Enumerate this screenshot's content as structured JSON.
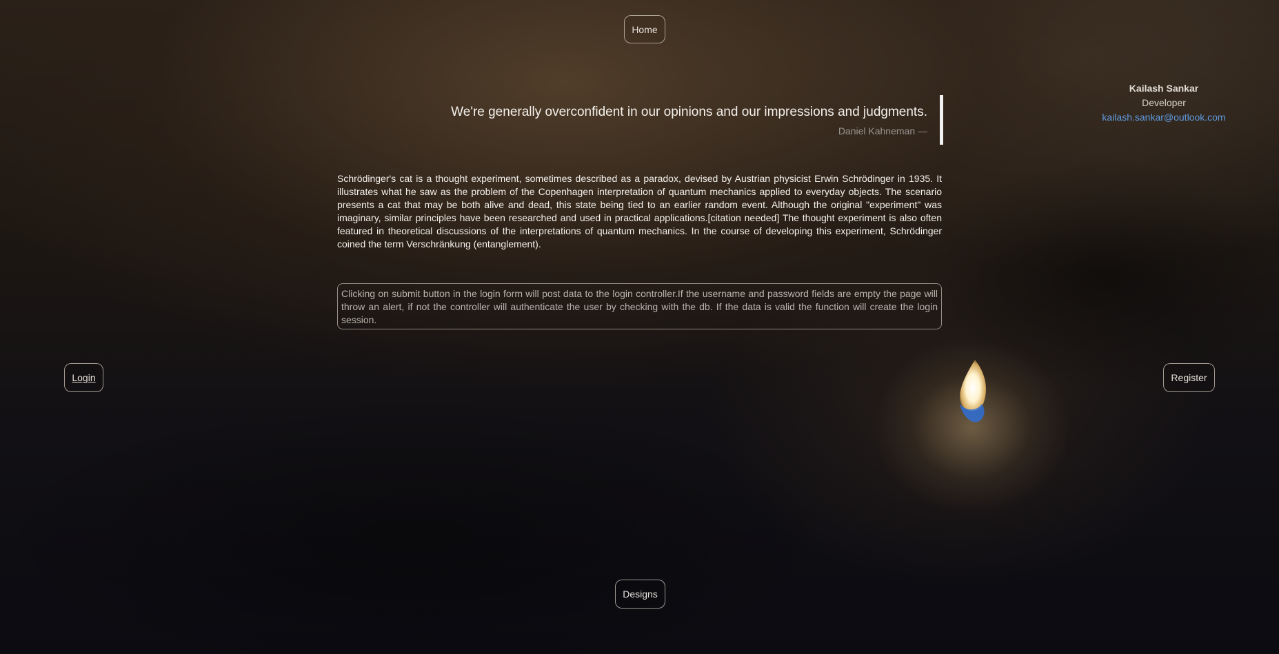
{
  "nav": {
    "home_label": "Home",
    "login_label": "Login",
    "register_label": "Register",
    "designs_label": "Designs"
  },
  "profile": {
    "name": "Kailash Sankar",
    "role": "Developer",
    "email": "kailash.sankar@outlook.com"
  },
  "quote": {
    "text": "We're generally overconfident in our opinions and our impressions and judgments.",
    "author": "Daniel Kahneman —"
  },
  "article": {
    "text": "Schrödinger's cat is a thought experiment, sometimes described as a paradox, devised by Austrian physicist Erwin Schrödinger in 1935. It illustrates what he saw as the problem of the Copenhagen interpretation of quantum mechanics applied to everyday objects. The scenario presents a cat that may be both alive and dead, this state being tied to an earlier random event. Although the original \"experiment\" was imaginary, similar principles have been researched and used in practical applications.[citation needed] The thought experiment is also often featured in theoretical discussions of the interpretations of quantum mechanics. In the course of developing this experiment, Schrödinger coined the term Verschränkung (entanglement)."
  },
  "note": {
    "text": "Clicking on submit button in the login form will post data to the login controller.If the username and password fields are empty the page will throw an alert, if not the controller will authenticate the user by checking with the db. If the data is valid the function will create the login session."
  },
  "theme": {
    "email_color": "#5f9be0",
    "quote_bar_color": "#f2f2f2"
  }
}
